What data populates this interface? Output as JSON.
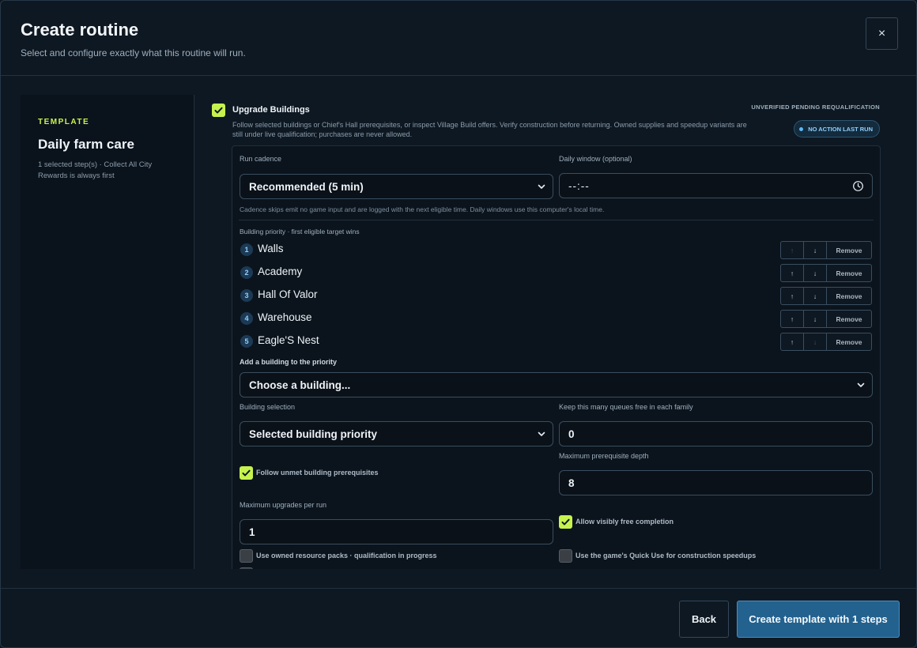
{
  "header": {
    "title": "Create routine",
    "subtitle": "Select and configure exactly what this routine will run.",
    "close_icon": "×"
  },
  "sidebar": {
    "label": "TEMPLATE",
    "name": "Daily farm care",
    "description": "1 selected step(s) · Collect All City Rewards is always first"
  },
  "step": {
    "title": "Upgrade Buildings",
    "checked": true,
    "description": "Follow selected buildings or Chief's Hall prerequisites, or inspect Village Build offers. Verify construction before returning. Owned supplies and speedup variants are still under live qualification; purchases are never allowed.",
    "status_label": "UNVERIFIED PENDING REQUALIFICATION",
    "badge": "NO ACTION LAST RUN"
  },
  "config": {
    "run_cadence_label": "Run cadence",
    "run_cadence_value": "Recommended (5 min)",
    "daily_window_label": "Daily window (optional)",
    "daily_window_value": "--:--",
    "cadence_hint": "Cadence skips emit no game input and are logged with the next eligible time. Daily windows use this computer's local time.",
    "priority_label": "Building priority · first eligible target wins",
    "priority": [
      {
        "num": "1",
        "name": "Walls"
      },
      {
        "num": "2",
        "name": "Academy"
      },
      {
        "num": "3",
        "name": "Hall Of Valor"
      },
      {
        "num": "4",
        "name": "Warehouse"
      },
      {
        "num": "5",
        "name": "Eagle'S Nest"
      }
    ],
    "up_symbol": "↑",
    "down_symbol": "↓",
    "remove_label": "Remove",
    "add_building_label": "Add a building to the priority",
    "add_building_value": "Choose a building...",
    "selection_label": "Building selection",
    "selection_value": "Selected building priority",
    "queues_label": "Keep this many queues free in each family",
    "queues_value": "0",
    "follow_prereq_label": "Follow unmet building prerequisites",
    "max_depth_label": "Maximum prerequisite depth",
    "max_depth_value": "8",
    "max_upgrades_label": "Maximum upgrades per run",
    "max_upgrades_value": "1",
    "free_completion_label": "Allow visibly free completion",
    "resource_packs_label": "Use owned resource packs · qualification in progress",
    "quick_use_label": "Use the game's Quick Use for construction speedups"
  },
  "footer": {
    "back_label": "Back",
    "create_label": "Create template with 1 steps"
  },
  "colors": {
    "accent": "#c6f24e",
    "primary_button": "#23618e",
    "badge_text": "#8fd0ff"
  }
}
